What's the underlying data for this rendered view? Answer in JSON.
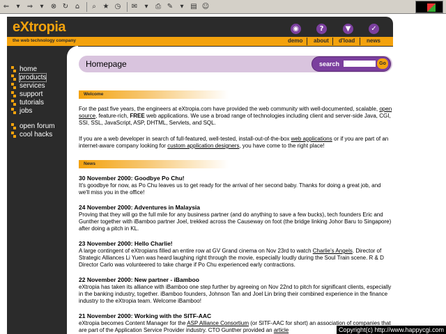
{
  "browser": {
    "toolbar_icons": [
      "back-arrow",
      "back-dropdown",
      "forward-arrow",
      "forward-dropdown",
      "stop",
      "refresh",
      "home",
      "search",
      "favorites",
      "history",
      "mail",
      "print",
      "edit",
      "discuss",
      "messenger"
    ]
  },
  "site": {
    "logo": "eXtropia",
    "tagline": "the web technology company",
    "accent_color": "#f3a20d",
    "dark_color": "#2b2b2b",
    "purple_color": "#7b3f9e"
  },
  "nav": [
    {
      "label": "demo",
      "icon": "eye-icon",
      "glyph": "◉"
    },
    {
      "label": "about",
      "icon": "question-icon",
      "glyph": "?"
    },
    {
      "label": "d'load",
      "icon": "download-icon",
      "glyph": "▼"
    },
    {
      "label": "news",
      "icon": "check-icon",
      "glyph": "✓"
    }
  ],
  "sidebar": {
    "items": [
      {
        "label": "home"
      },
      {
        "label": "products"
      },
      {
        "label": "services"
      },
      {
        "label": "support"
      },
      {
        "label": "tutorials"
      },
      {
        "label": "jobs"
      },
      {
        "label": "open forum"
      },
      {
        "label": "cool hacks"
      }
    ]
  },
  "page": {
    "title": "Homepage",
    "search_label": "search",
    "search_value": "",
    "go_label": "Go"
  },
  "welcome": {
    "label": "Welcome",
    "p1_a": "For the past five years, the engineers at eXtropia.com have provided the web community with well-documented, scalable, ",
    "p1_link": "open source",
    "p1_b": ", feature-rich, ",
    "p1_bold": "FREE",
    "p1_c": " web applications. We use a broad range of technologies including client and server-side Java, CGI, SSI, SSL, JavaScript, ASP, DHTML, Servlets, and SQL.",
    "p2_a": "If you are a web developer in search of full-featured, well-tested, install-out-of-the-box ",
    "p2_link1": "web applications",
    "p2_b": " or if you are part of an internet-aware company looking for ",
    "p2_link2": "custom application designers",
    "p2_c": ", you have come to the right place!"
  },
  "news": {
    "label": "News",
    "items": [
      {
        "title": "30 November 2000: Goodbye Po Chu!",
        "body": "It's goodbye for now, as Po Chu leaves us to get ready for the arrival of her second baby. Thanks for doing a great job, and we'll miss you in the office!"
      },
      {
        "title": "24 November 2000: Adventures in Malaysia",
        "body": "Proving that they will go the full mile for any business partner (and do anything to save a few bucks), tech founders Eric and Gunther together with iBamboo partner Joel, trekked across the Causeway on foot (the bridge linking Johor Baru to Singapore) after doing a pitch in KL."
      },
      {
        "title": "23 November 2000: Hello Charlie!",
        "body_a": "A large contingent of eXtropians filled an entire row at GV Grand cinema on Nov 23rd to watch ",
        "body_link": "Charlie's Angels",
        "body_b": ". Director of Strategic Alliances Li Yuen was heard laughing right through the movie, especially loudly during the Soul Train scene. R & D Director Carlo was volunteered to take charge if Po Chu experienced early contractions."
      },
      {
        "title": "22 November 2000: New partner - iBamboo",
        "body": "eXtropia has taken its alliance with iBamboo one step further by agreeing on Nov 22nd to pitch for significant clients, especially in the banking industry, together. iBamboo founders, Johnson Tan and Joel Lin bring their combined experience in the finance industry to the eXtropia team. Welcome iBamboo!"
      },
      {
        "title": "21 November 2000: Working with the SITF-AAC",
        "body_a": "eXtropia becomes Content Manager for the ",
        "body_link": "ASP Alliance Consortium",
        "body_b": " (or SITF-AAC for short) an association of companies that are part of the Application Service Provider industry. CTO Gunther provided an ",
        "body_link2": "article"
      }
    ]
  },
  "overlay": {
    "copyright": "Copyright(c) http://www.happycgi.com"
  }
}
